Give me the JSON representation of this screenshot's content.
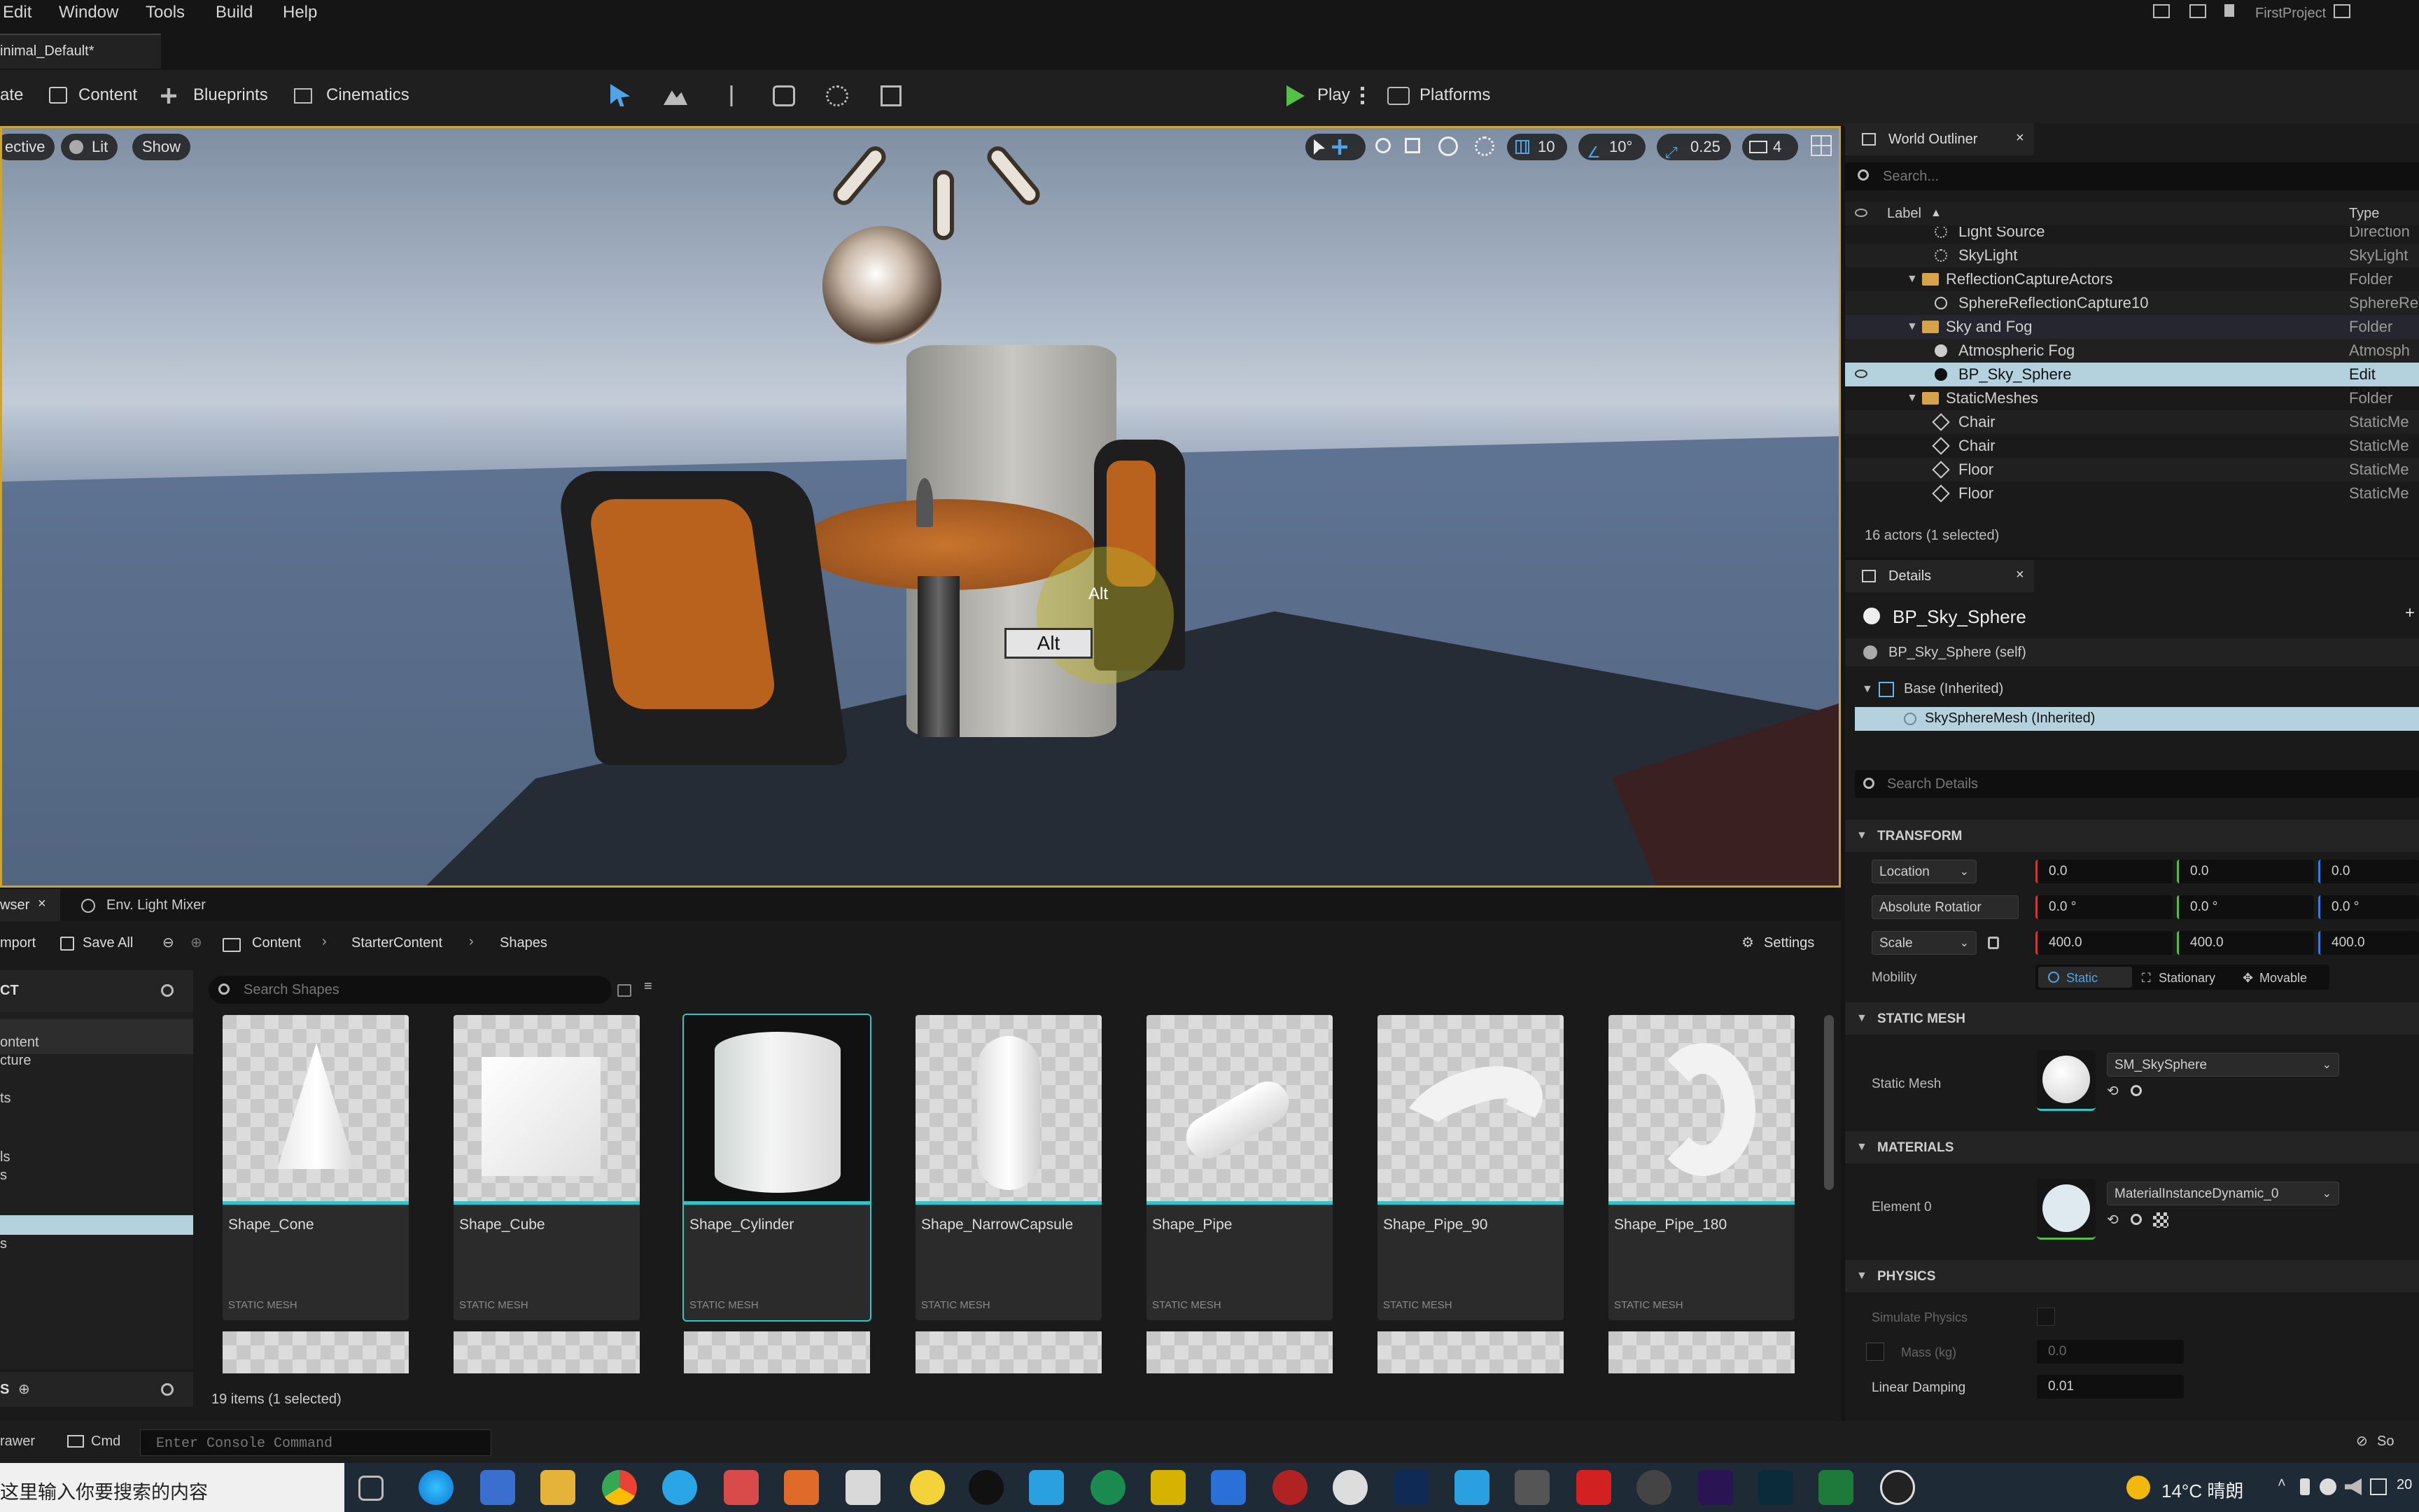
{
  "menu": [
    "Edit",
    "Window",
    "Tools",
    "Build",
    "Help"
  ],
  "title_right": "FirstProject",
  "level_tab": "inimal_Default*",
  "toolbar": {
    "save_partial": "ate",
    "content": "Content",
    "blueprints": "Blueprints",
    "cinematics": "Cinematics",
    "play": "Play",
    "platforms": "Platforms"
  },
  "viewport": {
    "perspective_partial": "ective",
    "lit": "Lit",
    "show": "Show",
    "grid_snap": "10",
    "rot_snap": "10°",
    "scale_snap": "0.25",
    "cam_speed": "4",
    "alt_badge": "Alt",
    "alt_key": "Alt"
  },
  "outliner": {
    "tab": "World Outliner",
    "search_placeholder": "Search...",
    "col_label": "Label",
    "col_type": "Type",
    "rows": [
      {
        "label": "Light Source",
        "type": "Direction"
      },
      {
        "label": "SkyLight",
        "type": "SkyLight"
      },
      {
        "label": "ReflectionCaptureActors",
        "type": "Folder"
      },
      {
        "label": "SphereReflectionCapture10",
        "type": "SphereRe"
      },
      {
        "label": "Sky and Fog",
        "type": "Folder"
      },
      {
        "label": "Atmospheric Fog",
        "type": "Atmosph"
      },
      {
        "label": "BP_Sky_Sphere",
        "type": "Edit BP_S"
      },
      {
        "label": "StaticMeshes",
        "type": "Folder"
      },
      {
        "label": "Chair",
        "type": "StaticMe"
      },
      {
        "label": "Chair",
        "type": "StaticMe"
      },
      {
        "label": "Floor",
        "type": "StaticMe"
      },
      {
        "label": "Floor",
        "type": "StaticMe"
      }
    ],
    "status": "16 actors (1 selected)"
  },
  "details": {
    "tab": "Details",
    "object": "BP_Sky_Sphere",
    "self": "BP_Sky_Sphere (self)",
    "base": "Base (Inherited)",
    "component": "SkySphereMesh (Inherited)",
    "search_placeholder": "Search Details",
    "transform": "TRANSFORM",
    "location": "Location",
    "rotation": "Absolute Rotatior",
    "scale": "Scale",
    "loc": [
      "0.0",
      "0.0",
      "0.0"
    ],
    "rot": [
      "0.0 °",
      "0.0 °",
      "0.0 °"
    ],
    "scl": [
      "400.0",
      "400.0",
      "400.0"
    ],
    "mobility": "Mobility",
    "static": "Static",
    "stationary": "Stationary",
    "movable": "Movable",
    "static_mesh_section": "STATIC MESH",
    "static_mesh_label": "Static Mesh",
    "static_mesh_value": "SM_SkySphere",
    "materials_section": "MATERIALS",
    "element0": "Element 0",
    "material_value": "MaterialInstanceDynamic_0",
    "physics_section": "PHYSICS",
    "simulate": "Simulate Physics",
    "mass": "Mass (kg)",
    "mass_value": "0.0",
    "damping": "Linear Damping",
    "damping_value": "0.01"
  },
  "content_browser": {
    "tab1": "wser",
    "tab2": "Env. Light Mixer",
    "import": "mport",
    "save_all": "Save All",
    "crumbs": [
      "Content",
      "StarterContent",
      "Shapes"
    ],
    "settings": "Settings",
    "search_placeholder": "Search Shapes",
    "tree_header": "CT",
    "tree": [
      "ontent",
      "cture",
      "ts",
      "ls",
      "s",
      "",
      "s"
    ],
    "tree_footer": "S",
    "assets": [
      {
        "name": "Shape_Cone",
        "type": "STATIC MESH"
      },
      {
        "name": "Shape_Cube",
        "type": "STATIC MESH"
      },
      {
        "name": "Shape_Cylinder",
        "type": "STATIC MESH"
      },
      {
        "name": "Shape_NarrowCapsule",
        "type": "STATIC MESH"
      },
      {
        "name": "Shape_Pipe",
        "type": "STATIC MESH"
      },
      {
        "name": "Shape_Pipe_90",
        "type": "STATIC MESH"
      },
      {
        "name": "Shape_Pipe_180",
        "type": "STATIC MESH"
      }
    ],
    "count": "19 items (1 selected)"
  },
  "statusbar": {
    "drawer": "rawer",
    "cmd": "Cmd",
    "console_placeholder": "Enter Console Command",
    "right": "So"
  },
  "taskbar": {
    "search": "这里输入你要搜索的内容",
    "weather": "14°C 晴朗",
    "time": "20"
  }
}
